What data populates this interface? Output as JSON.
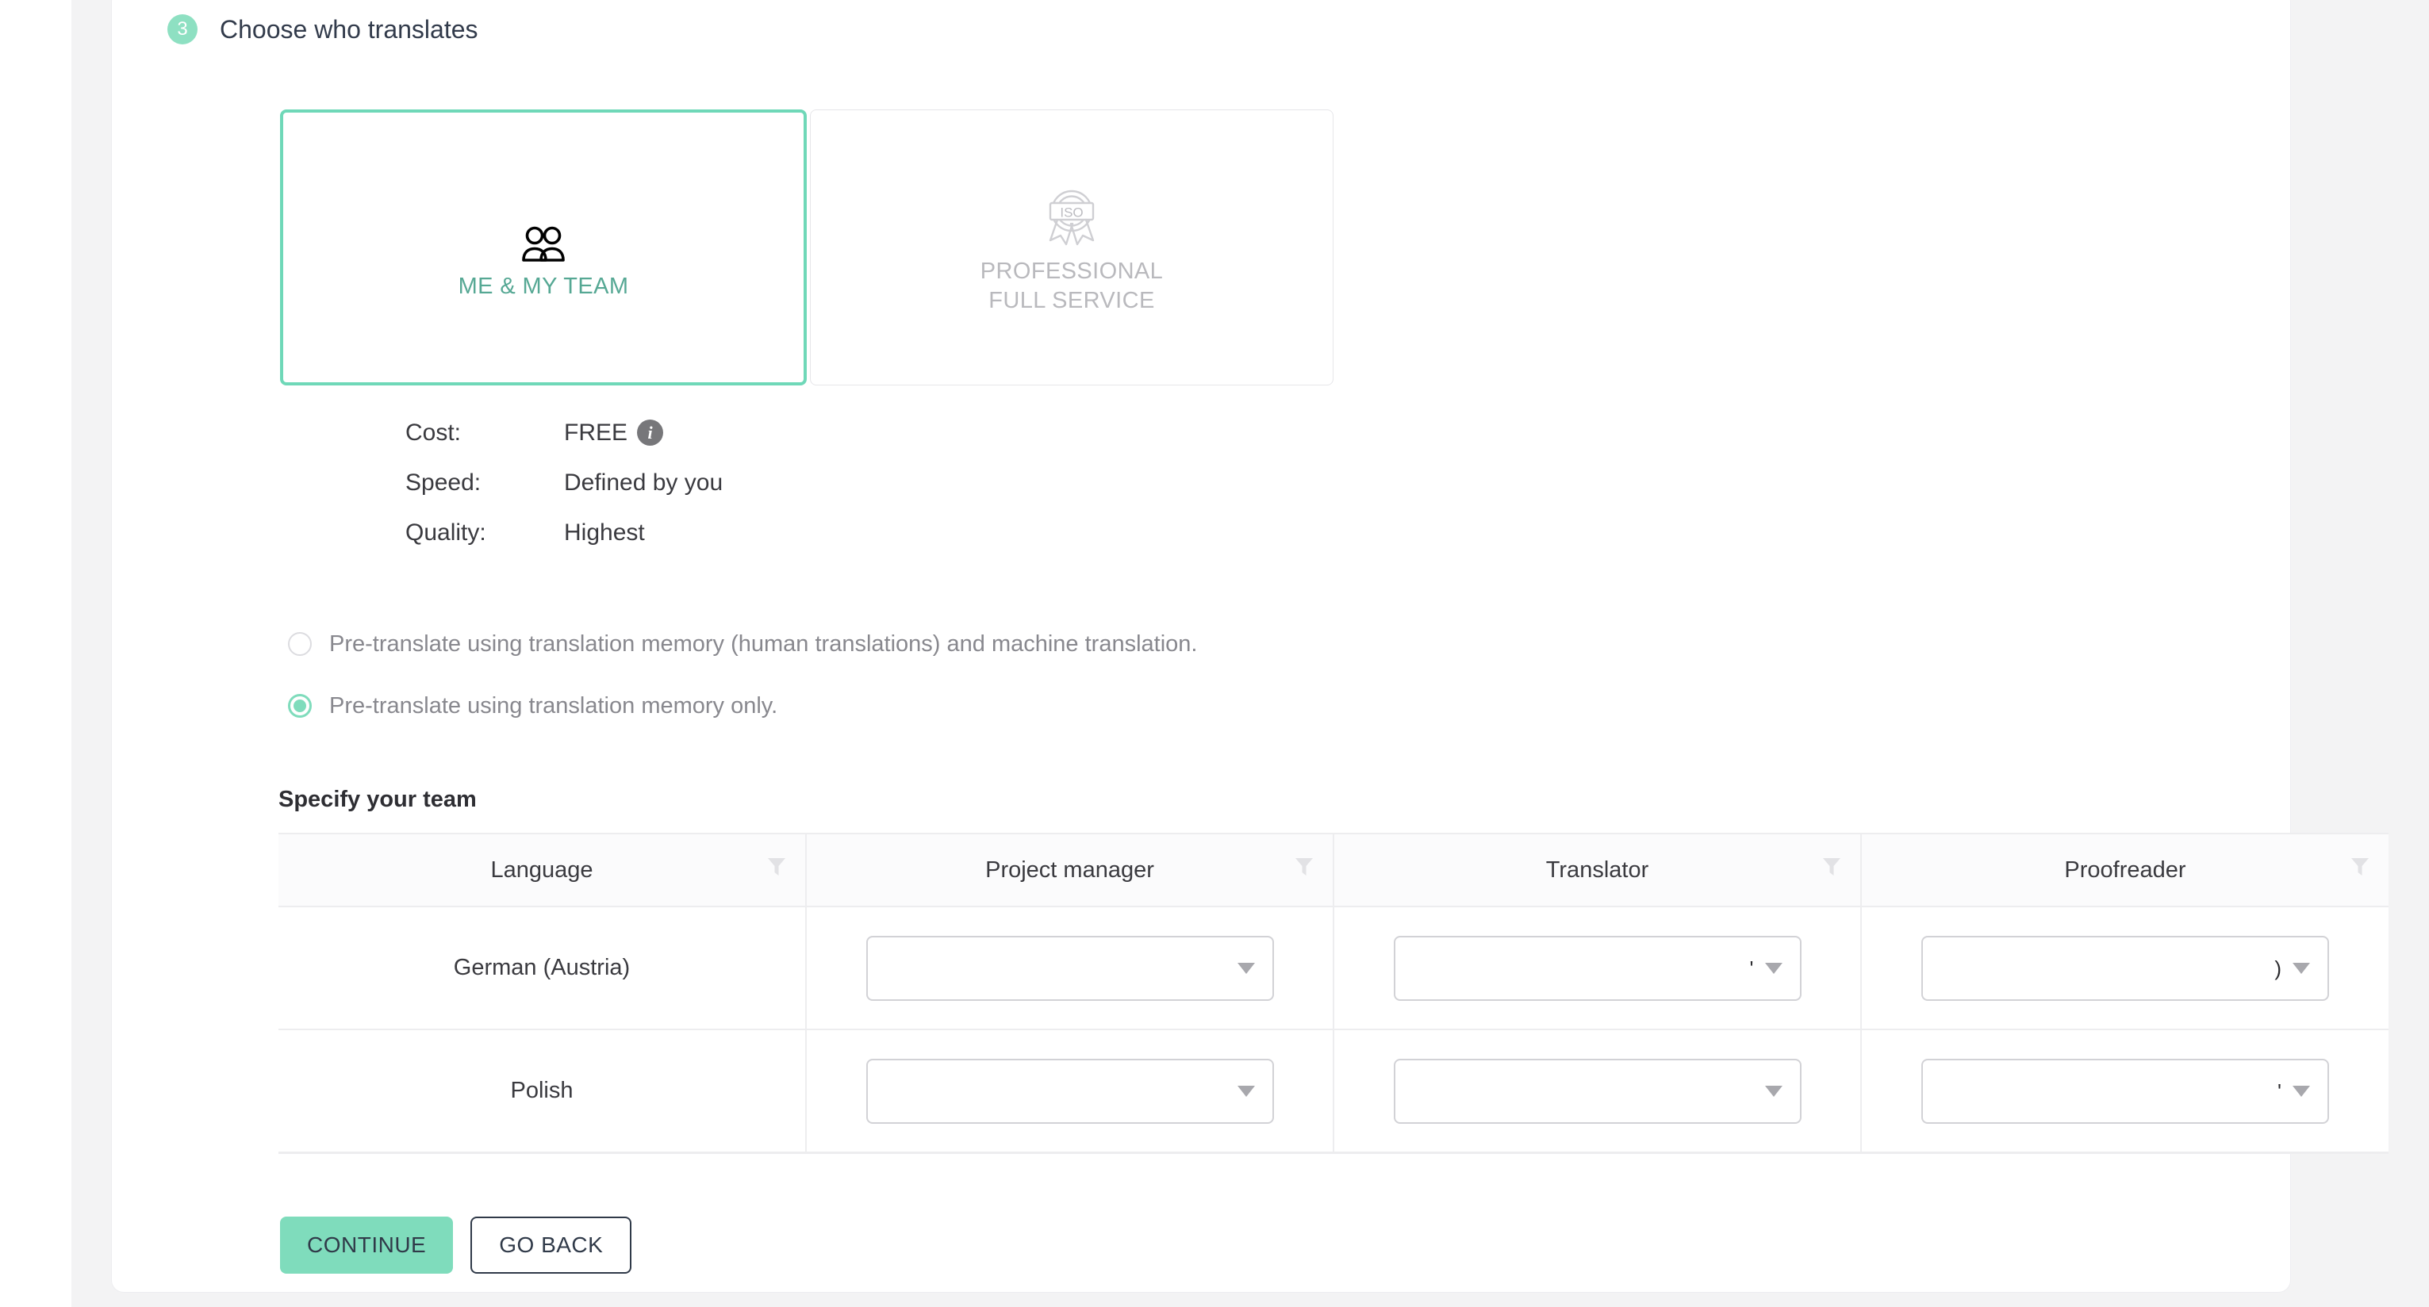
{
  "step": {
    "number": "3",
    "title": "Choose who translates"
  },
  "options": [
    {
      "id": "me-and-my-team",
      "label_line1": "ME & MY TEAM",
      "icon": "people-icon",
      "selected": true
    },
    {
      "id": "professional-full-service",
      "label_line1": "PROFESSIONAL",
      "label_line2": "FULL SERVICE",
      "icon": "iso-badge-icon",
      "selected": false
    }
  ],
  "details": [
    {
      "key": "Cost:",
      "value": "FREE",
      "has_info": true
    },
    {
      "key": "Speed:",
      "value": "Defined by you",
      "has_info": false
    },
    {
      "key": "Quality:",
      "value": "Highest",
      "has_info": false
    }
  ],
  "info_icon_glyph": "i",
  "pretranslate_options": [
    {
      "label": "Pre-translate using translation memory (human translations) and machine translation.",
      "selected": false
    },
    {
      "label": "Pre-translate using translation memory only.",
      "selected": true
    }
  ],
  "team_section": {
    "title": "Specify your team",
    "columns": [
      "Language",
      "Project manager",
      "Translator",
      "Proofreader"
    ],
    "rows": [
      {
        "language": "German (Austria)",
        "project_manager": "",
        "translator": "",
        "proofreader": ""
      },
      {
        "language": "Polish",
        "project_manager": "",
        "translator": "",
        "proofreader": ""
      }
    ]
  },
  "footer": {
    "continue_label": "CONTINUE",
    "go_back_label": "GO BACK"
  },
  "colors": {
    "accent_mint": "#7fdcbc",
    "badge_mint": "#8ee0c2",
    "teal_text": "#56a894",
    "muted_text": "#b9b9bd",
    "dark_text": "#303a49"
  }
}
